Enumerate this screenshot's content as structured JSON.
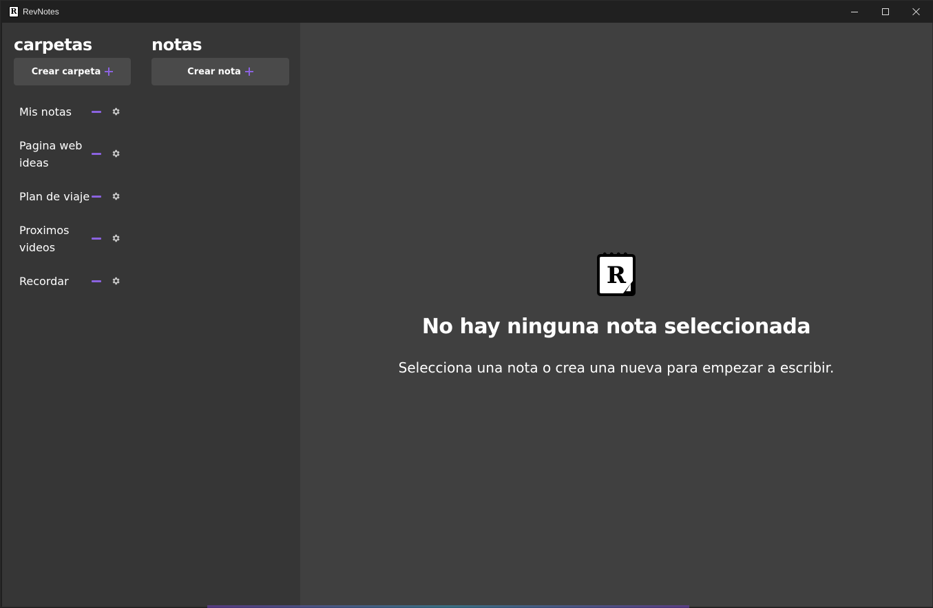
{
  "window": {
    "title": "RevNotes",
    "app_icon_letter": "R"
  },
  "sidebar": {
    "folders_title": "carpetas",
    "notes_title": "notas",
    "create_folder_label": "Crear carpeta",
    "create_note_label": "Crear nota",
    "folders": [
      {
        "label": "Mis notas"
      },
      {
        "label": "Pagina web ideas"
      },
      {
        "label": "Plan de viaje"
      },
      {
        "label": "Proximos videos"
      },
      {
        "label": "Recordar"
      }
    ]
  },
  "main": {
    "logo_letter": "R",
    "empty_title": "No hay ninguna nota seleccionada",
    "empty_subtitle": "Selecciona una nota o crea una nueva para empezar a escribir."
  },
  "colors": {
    "accent": "#8b63e0",
    "sidebar_bg": "#363636",
    "main_bg": "#404040",
    "button_bg": "#4a4a4a",
    "titlebar_bg": "#202020"
  },
  "icons": [
    "plus-icon",
    "minus-icon",
    "gear-icon",
    "minimize-icon",
    "maximize-icon",
    "close-icon"
  ]
}
